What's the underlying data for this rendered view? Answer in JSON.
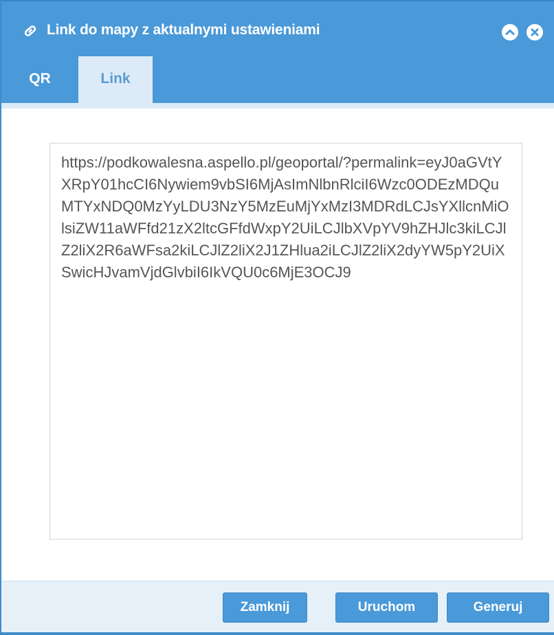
{
  "dialog": {
    "title": "Link do mapy z aktualnymi ustawieniami",
    "title_icon": "link-icon",
    "collapse_icon": "chevron-up-icon",
    "close_icon": "close-icon"
  },
  "tabs": [
    {
      "label": "QR",
      "active": false
    },
    {
      "label": "Link",
      "active": true
    }
  ],
  "link": {
    "value": "https://podkowalesna.aspello.pl/geoportal/?permalink=eyJ0aGVtYXRpY01hcCI6Nywiem9vbSI6MjAsImNlbnRlciI6Wzc0ODEzMDQuMTYxNDQ0MzYyLDU3NzY5MzEuMjYxMzI3MDRdLCJsYXllcnMiOlsiZW11aWFfd21zX2ltcGFfdWxpY2UiLCJlbXVpYV9hZHJlc3kiLCJlZ2liX2R6aWFsa2kiLCJlZ2liX2J1ZHlua2iLCJlZ2liX2dyYW5pY2UiXSwicHJvamVjdGlvbiI6IkVQU0c6MjE3OCJ9"
  },
  "footer": {
    "close_label": "Zamknij",
    "run_label": "Uruchom",
    "generate_label": "Generuj"
  },
  "colors": {
    "header": "#4a99d8",
    "active_tab": "#dcebf7",
    "footer": "#e6f0f9",
    "button": "#4a99d8"
  }
}
